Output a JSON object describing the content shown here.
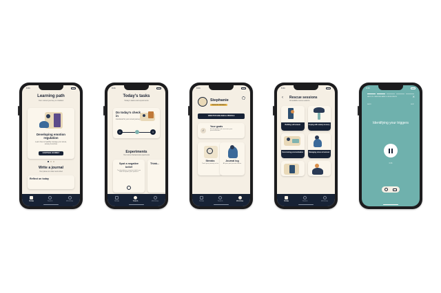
{
  "tabs": {
    "home": "HOME",
    "tasks": "TASKS",
    "profile": "PROFILE"
  },
  "phone1": {
    "title": "Learning path",
    "subtitle": "Your current journey on Intellect",
    "card_title": "Developing emotion regulation",
    "card_desc": "Learn how to healthily manage your stress, anxiety & worries",
    "card_button": "CONTINUE JOURNEY",
    "section_title": "Write a journal",
    "section_sub": "Your places to reflect and reflect",
    "peek_text": "Reflect on today"
  },
  "phone2": {
    "title": "Today's tasks",
    "subtitle": "Today's tasks and experiments",
    "checkin_title": "Do today's check in",
    "checkin_sub": "Intentional for your current journey",
    "steps": [
      "1",
      "",
      "3"
    ],
    "section_title": "Experiments",
    "section_sub": "Your current behavioural experiments",
    "exp1_title": "Spot a negative belief",
    "exp1_desc": "Try identifying a negative belief you hold to explore your patterns",
    "exp2_title": "Think..."
  },
  "phone3": {
    "name": "Stephanie",
    "badge": "PREMIUM MEMBER",
    "view_button": "VIEW PSYCHOLOGICAL PROFILE",
    "goals_title": "Your goals",
    "goals_desc": "Be thoughtful and overcome your procrastination",
    "streaks_title": "Streaks",
    "streaks_desc": "Track your journey so far",
    "journal_title": "Journal log",
    "journal_desc": "All your past journal entries"
  },
  "phone4": {
    "title": "Rescue sessions",
    "subtitle": "All available rescue sessions",
    "sessions": [
      "Building self-esteem",
      "Coping with anxiety & worry",
      "Overcoming procrastination",
      "Managing stress & burnout",
      "",
      ""
    ]
  },
  "phone5": {
    "header": "HELD IN: SEEKING AWAY & RESILIENCE",
    "left_label": "BACK",
    "right_label": "SKIP",
    "title": "Identifying your triggers",
    "time": "0:33",
    "colors": {
      "background": "#6fb1ad"
    }
  },
  "colors": {
    "navy": "#172235",
    "cream": "#f5efe4",
    "accent": "#e8b64c",
    "teal": "#6fb1ad"
  }
}
